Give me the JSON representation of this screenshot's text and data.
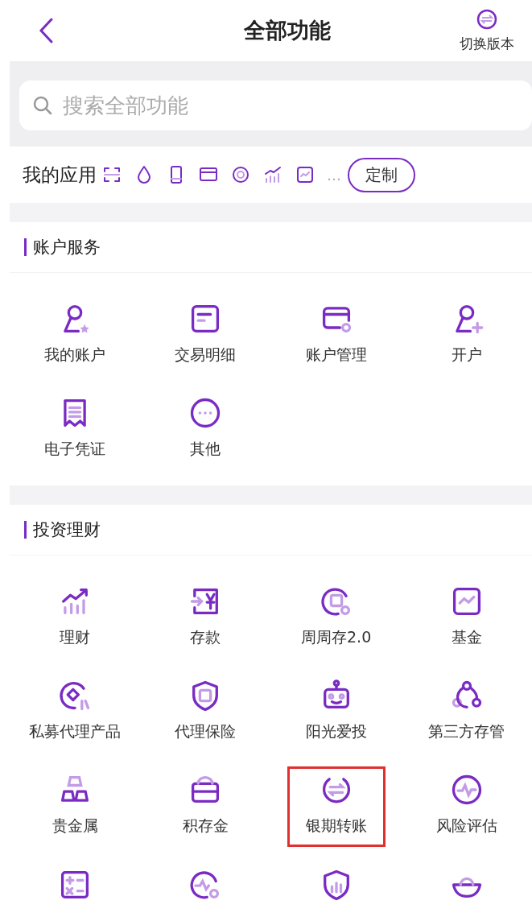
{
  "header": {
    "title": "全部功能",
    "switch_label": "切换版本"
  },
  "search": {
    "placeholder": "搜索全部功能"
  },
  "my_apps": {
    "label": "我的应用",
    "more": "…",
    "customize": "定制"
  },
  "sections": [
    {
      "title": "账户服务",
      "items": [
        {
          "kind": "app",
          "label": "我的账户",
          "highlighted": false
        },
        {
          "kind": "app",
          "label": "交易明细",
          "highlighted": false
        },
        {
          "kind": "app",
          "label": "账户管理",
          "highlighted": false
        },
        {
          "kind": "app",
          "label": "开户",
          "highlighted": false
        },
        {
          "kind": "app",
          "label": "电子凭证",
          "highlighted": false
        },
        {
          "kind": "app",
          "label": "其他",
          "highlighted": false
        }
      ]
    },
    {
      "title": "投资理财",
      "items": [
        {
          "kind": "app",
          "label": "理财",
          "highlighted": false
        },
        {
          "kind": "app",
          "label": "存款",
          "highlighted": false
        },
        {
          "kind": "app",
          "label": "周周存2.0",
          "highlighted": false
        },
        {
          "kind": "app",
          "label": "基金",
          "highlighted": false
        },
        {
          "kind": "app",
          "label": "私募代理产品",
          "highlighted": false
        },
        {
          "kind": "app",
          "label": "代理保险",
          "highlighted": false
        },
        {
          "kind": "app",
          "label": "阳光爱投",
          "highlighted": false
        },
        {
          "kind": "app",
          "label": "第三方存管",
          "highlighted": false
        },
        {
          "kind": "app",
          "label": "贵金属",
          "highlighted": false
        },
        {
          "kind": "app",
          "label": "积存金",
          "highlighted": false
        },
        {
          "kind": "app",
          "label": "银期转账",
          "highlighted": true
        },
        {
          "kind": "app",
          "label": "风险评估",
          "highlighted": false
        },
        {
          "kind": "icon"
        },
        {
          "kind": "icon"
        },
        {
          "kind": "icon"
        },
        {
          "kind": "icon"
        }
      ]
    }
  ]
}
